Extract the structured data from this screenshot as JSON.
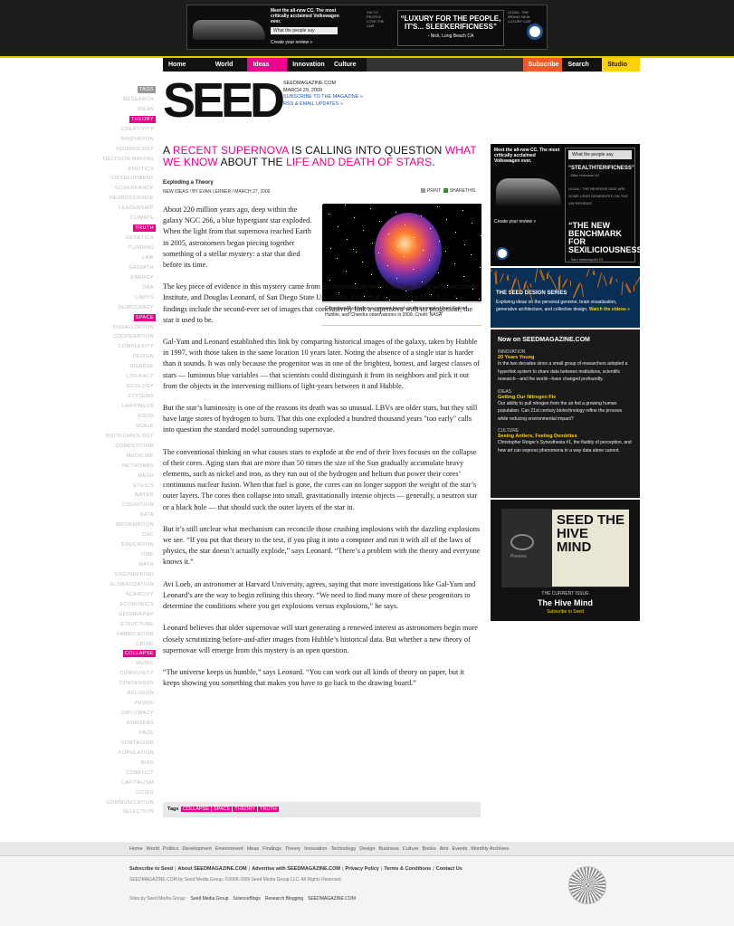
{
  "ad_banner": {
    "tagline": "Meet the all-new CC. The most critically acclaimed Volkswagen ever.",
    "button": "What the people say",
    "cta": "Create your review »",
    "left_fine": "VW CC PEOPLE LOVE THE CAR",
    "quote": "“LUXURY FOR THE PEOPLE, IT'S... SLEEKERIFICNESS”",
    "quote_by": "- Nick, Long Beach CA",
    "right_fine": "LEGAL: THE BRAND NEW LUXURY CAR",
    "brand_color": "#1d4f91"
  },
  "nav": {
    "items": [
      {
        "label": "Home",
        "color": "#111111"
      },
      {
        "label": "World",
        "color": "#111111"
      },
      {
        "label": "Ideas",
        "color": "#ec008c"
      },
      {
        "label": "Innovation",
        "color": "#111111"
      },
      {
        "label": "Culture",
        "color": "#111111"
      },
      {
        "label": "",
        "color": "#333333"
      },
      {
        "label": "Subscribe",
        "color": "#f05a28"
      },
      {
        "label": "Search",
        "color": "#111111"
      },
      {
        "label": "Studio",
        "color": "#ffd200"
      }
    ]
  },
  "leftnav": {
    "header": "TAGS",
    "items": [
      "RESEARCH",
      "IDEAS",
      "THEORY",
      "CREATIVITY",
      "INNOVATION",
      "TECHNOLOGY",
      "DECISION MAKING",
      "POLITICS",
      "DEVELOPMENT",
      "GOVERNANCE",
      "NEUROSCIENCE",
      "LEADERSHIP",
      "CLIMATE",
      "TRUTH",
      "GENETICS",
      "FUNDING",
      "LAW",
      "GROWTH",
      "ENERGY",
      "DNA",
      "LIMITS",
      "DEMOCRACY",
      "SPACE",
      "VISUALIZATION",
      "COOPERATION",
      "COMPLEXITY",
      "DESIGN",
      "DISEASE",
      "LITERACY",
      "ECOLOGY",
      "SYSTEMS",
      "HAPPINESS",
      "FOOD",
      "SCALE",
      "BIOTECHNOLOGY",
      "COMPETITION",
      "MEDICINE",
      "NETWORKS",
      "MESH",
      "ETHICS",
      "WATER",
      "COGNITION",
      "DATA",
      "INFORMATION",
      "CHC",
      "EDUCATION",
      "TIME",
      "MATH",
      "ENGINEERING",
      "GLOBALIZATION",
      "SCARCITY",
      "ECONOMICS",
      "GEOGRAPHY",
      "STRUCTURE",
      "FABRICATION",
      "CRIME",
      "COLLAPSE",
      "MUSIC",
      "COMMUNITY",
      "CONSENSUS",
      "RELIGION",
      "PROOF",
      "DIPLOMACY",
      "BORDERS",
      "PACE",
      "CONTAGION",
      "POPULATION",
      "BIAS",
      "CONFLICT",
      "CAPITALISM",
      "CITIES",
      "COMMUNICATION",
      "SELECTION"
    ],
    "highlighted": [
      "THEORY",
      "TRUTH",
      "SPACE",
      "COLLAPSE"
    ]
  },
  "logo": "SEED",
  "siteinfo": {
    "site": "SEEDMAGAZINE.COM",
    "date": "MARCH 29, 2009",
    "subscribe": "SUBSCRIBE TO THE MAGAZINE »",
    "rss": "RSS & EMAIL UPDATES »"
  },
  "article": {
    "headline": {
      "p1": "A ",
      "p2": "RECENT SUPERNOVA",
      "p3": " IS CALLING INTO QUESTION ",
      "p4": "WHAT WE KNOW",
      "p5": " ABOUT THE ",
      "p6": "LIFE AND DEATH OF STARS",
      "p7": "."
    },
    "title": "Exploding a Theory",
    "byline": "NEW IDEAS / BY EVAN LERNER / MARCH 27, 2009",
    "print": "PRINT",
    "sharethis": "SHARETHIS",
    "caption": "Cassiopeia A supernova remnant based on data compiled from Spitzer, Hubble, and Chandra observatories in 2008. Credit: NASA",
    "p1": "About 220 million years ago, deep within the galaxy NGC 266, a blue hypergiant star exploded. When the light from that supernova reached Earth in 2005, astronomers began piecing together something of a stellar mystery: a star that died before its time.",
    "p2a": "The key piece of evidence in this mystery came from astronomers Avishay Gal-Yam, of Israel’s Weizmann Institute, and Douglas Leonard, of San Diego State University. Published in ",
    "p2i": "Nature",
    "p2b": " on March 22, their findings include the second-ever set of images that conclusively link a supernova with its progenitor, the star it used to be.",
    "p3": "Gal-Yam and Leonard established this link by comparing historical images of the galaxy, taken by Hubble in 1997, with those taken in the same location 10 years later. Noting the absence of a single star is harder than it sounds. It was only because the progenitor was in one of the brightest, hottest, and largest classes of stars — luminous blue variables  — that scientists could distinguish it from its neighbors and pick it out from the objects in the intervening millions of light-years between it and Hubble.",
    "p4": "But the star’s luminosity is one of the reasons its death was so unusual. LBVs are older stars, but they still have large stores of hydrogen to burn. That this one exploded a hundred thousand years \"too early\" calls into question the standard model surrounding supernovae.",
    "p5": "The conventional thinking on what causes stars to explode at the end of their lives focuses on the collapse of their cores. Aging stars that are more than 50 times the size of the Sun gradually accumulate heavy elements, such as nickel and iron, as they run out of the hydrogen and helium that power their cores’ continuous nuclear fusion. When that fuel is gone, the cores can no longer support the weight of the star’s outer layers. The cores then collapse into small, gravitationally intense objects — generally, a neutron star or a black hole  — that should suck the outer layers of the star in.",
    "p6": "But it’s still unclear what mechanism can reconcile those crushing implosions with the dazzling explosions we see. “If you put that theory to the test, if you plug it into a computer and run it with all of the laws of physics, the star doesn’t actually explode,” says Leonard. “There’s a problem with the theory and everyone knows it.”",
    "p7": "Avi Loeb, an astronomer at Harvard University, agrees, saying that more investigations like Gal-Yam and Leonard’s are the way to begin refining this theory. “We need to find many more of these progenitors to determine the conditions where you get explosions versus explosions,” he says.",
    "p8": "Leonard believes that older supernovae will start generating a renewed interest as astronomers begin more closely scrutinizing before-and-after images from Hubble’s historical data. But whether a new theory of supernovae will emerge from this mystery is an open question.",
    "p9": "“The universe keeps us humble,” says Leonard. “You can work out all kinds of theory on paper, but it keeps showing you something that makes you have to go back to the drawing board.”",
    "tags_label": "Tags",
    "tags": [
      "COLLAPSE",
      "SPACE",
      "THEORY",
      "TRUTH"
    ]
  },
  "sidebar": {
    "ad": {
      "tagline": "Meet the all-new CC. The most critically acclaimed Volkswagen ever.",
      "create": "Create your review »",
      "button": "What the people say",
      "q1": "“STEALTHTERIFICNESS”",
      "q1_by": "- Mike Hobokan NJ",
      "q2_fine": "LEGAL: THE REVERSE SIDE ARE SOME USER GENERATED ON THE VW REVIEWS",
      "q3": "“THE NEW BENCHMARK FOR SEXILICIOUSNESS”",
      "q3_by": "- Sam Indianapolis IN"
    },
    "design": {
      "title": "THE SEED DESIGN SERIES",
      "desc": "Exploring ideas on the personal genome, brain visualization, generative architecture, and collective design. ",
      "link": "Watch the videos »"
    },
    "now": {
      "title": "Now on SEEDMAGAZINE.COM",
      "items": [
        {
          "cat": "INNOVATION",
          "title": "20 Years Young",
          "desc": "In the two decades since a small group of researchers adopted a hyperlink system to share data between institutions, scientific research—and the world—have changed profoundly."
        },
        {
          "cat": "IDEAS",
          "title": "Getting Our Nitrogen Fix",
          "desc": "Our ability to pull nitrogen from the air fed a growing human population. Can 21st century biotechnology refine the process while reducing environmental impact?"
        },
        {
          "cat": "CULTURE",
          "title": "Seeing Antlers, Feeling Dendrites",
          "desc": "Christopher Reiger's Synesthesia #1, the fluidity of perception, and how art can express phenomena in a way data alone cannot."
        }
      ]
    },
    "issue": {
      "cover": "SEED THE HIVE MIND",
      "preview": "Preview",
      "label": "THE CURRENT ISSUE",
      "title": "The Hive Mind",
      "subscribe": "Subscribe to Seed"
    }
  },
  "footer": {
    "links": [
      "Home",
      "World",
      "Politics",
      "Development",
      "Environment",
      "Ideas",
      "Findings",
      "Theory",
      "Innovation",
      "Technology",
      "Design",
      "Business",
      "Culture",
      "Books",
      "Arts",
      "Events",
      "Monthly Archives"
    ],
    "links2": [
      "Subscribe to Seed",
      "About SEEDMAGAZINE.COM",
      "Advertise with SEEDMAGAZINE.COM",
      "Privacy Policy",
      "Terms & Conditions",
      "Contact Us"
    ],
    "copy": "SEEDMAGAZINE.COM by Seed Media Group. ©2005-2009 Seed Media Group LLC. All Rights Reserved.",
    "sister_label": "Sites by Seed Media Group:",
    "sister": [
      "Seed Media Group",
      "ScienceBlogs",
      "Research Blogging",
      "SEEDMAGAZINE.COM"
    ]
  }
}
